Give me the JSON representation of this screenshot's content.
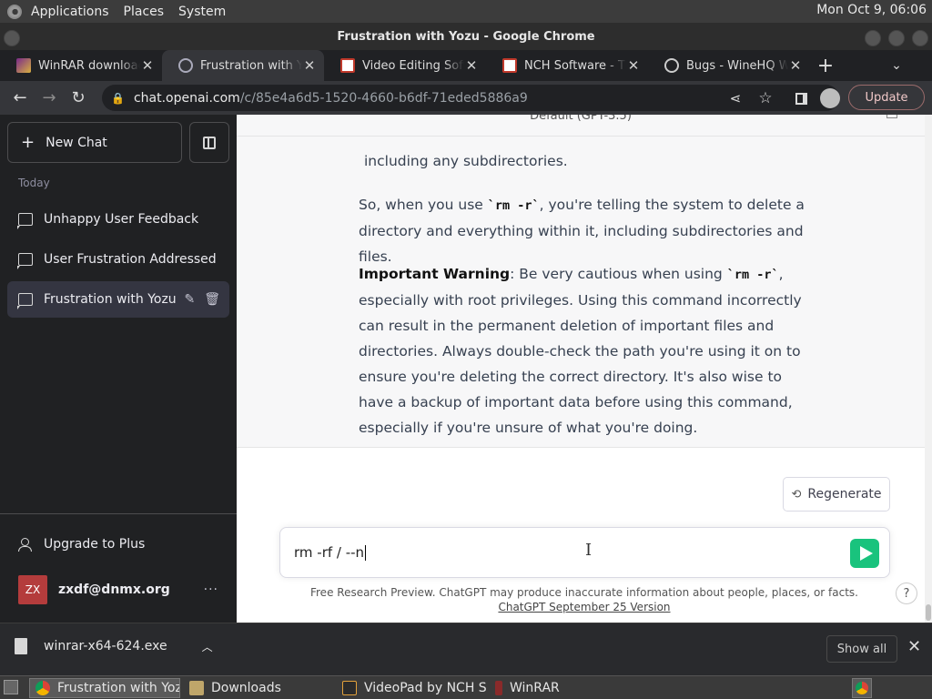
{
  "top_panel": {
    "menus": [
      "Applications",
      "Places",
      "System"
    ],
    "clock": "Mon Oct  9, 06:06"
  },
  "window": {
    "title": "Frustration with Yozu - Google Chrome"
  },
  "tabs": [
    {
      "label": "WinRAR download f",
      "icon": "winrar-icon"
    },
    {
      "label": "Frustration with Yozu",
      "icon": "openai-icon"
    },
    {
      "label": "Video Editing Software",
      "icon": "nch-icon"
    },
    {
      "label": "NCH Software - Tha",
      "icon": "nch-icon"
    },
    {
      "label": "Bugs - WineHQ Wiki",
      "icon": "globe-icon"
    }
  ],
  "omnibox": {
    "host": "chat.openai.com",
    "path": "/c/85e4a6d5-1520-4660-b6df-71eded5886a9"
  },
  "toolbar": {
    "update_label": "Update"
  },
  "sidebar": {
    "new_chat_label": "New Chat",
    "section_label": "Today",
    "conversations": [
      {
        "title": "Unhappy User Feedback"
      },
      {
        "title": "User Frustration Addressed"
      },
      {
        "title": "Frustration with Yozu"
      }
    ],
    "upgrade_label": "Upgrade to Plus",
    "account": {
      "initials": "ZX",
      "email": "zxdf@dnmx.org",
      "more": "···"
    }
  },
  "chat": {
    "model_header": "Default (GPT-3.5)",
    "message": {
      "p1": "including any subdirectories.",
      "p2_a": "So, when you use ",
      "p2_code": "`rm -r`",
      "p2_b": ", you're telling the system to delete a directory and everything within it, including subdirectories and files.",
      "p3_bold": "Important Warning",
      "p3_a": ": Be very cautious when using ",
      "p3_code": "`rm -r`",
      "p3_b": ", especially with root privileges. Using this command incorrectly can result in the permanent deletion of important files and directories. Always double-check the path you're using it on to ensure you're deleting the correct directory. It's also wise to have a backup of important data before using this command, especially if you're unsure of what you're doing."
    },
    "regenerate_label": "Regenerate",
    "input_value": "rm -rf / --n",
    "footer_text": "Free Research Preview. ChatGPT may produce inaccurate information about people, places, or facts. ",
    "footer_link": "ChatGPT September 25 Version",
    "help_label": "?"
  },
  "downloads": {
    "file_name": "winrar-x64-624.exe",
    "show_all_label": "Show all"
  },
  "taskbar": {
    "items": [
      {
        "label": "Frustration with Yoz...",
        "active": true
      },
      {
        "label": "Downloads",
        "active": false
      },
      {
        "label": "VideoPad by NCH S...",
        "active": false
      },
      {
        "label": "WinRAR",
        "active": false
      }
    ]
  },
  "colors": {
    "send_button": "#19c37d",
    "sidebar_bg": "#202123",
    "avatar_bg": "#b43c3c"
  }
}
